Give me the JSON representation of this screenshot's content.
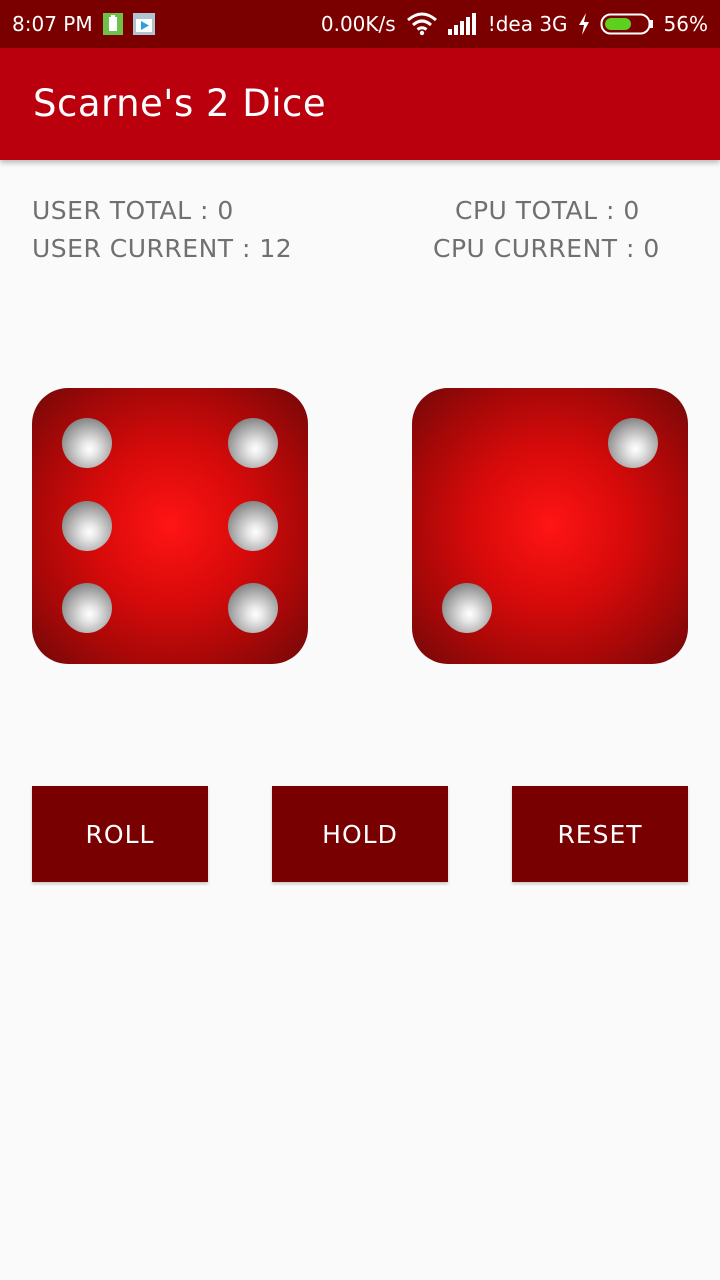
{
  "status_bar": {
    "time": "8:07 PM",
    "net_speed": "0.00K/s",
    "carrier": "!dea 3G",
    "battery": "56%",
    "icons": [
      "battery-saver-icon",
      "play-store-icon",
      "wifi-icon",
      "signal-icon",
      "charging-icon",
      "battery-icon"
    ]
  },
  "app_bar": {
    "title": "Scarne's 2 Dice",
    "color": "#bb000d"
  },
  "scores": {
    "user_total": "USER TOTAL : 0",
    "user_current": "USER CURRENT : 12",
    "cpu_total": "CPU TOTAL : 0",
    "cpu_current": "CPU CURRENT : 0"
  },
  "dice": [
    {
      "name": "user-die",
      "face": 6
    },
    {
      "name": "cpu-die",
      "face": 2
    }
  ],
  "buttons": {
    "roll": "ROLL",
    "hold": "HOLD",
    "reset": "RESET",
    "color": "#790000"
  }
}
